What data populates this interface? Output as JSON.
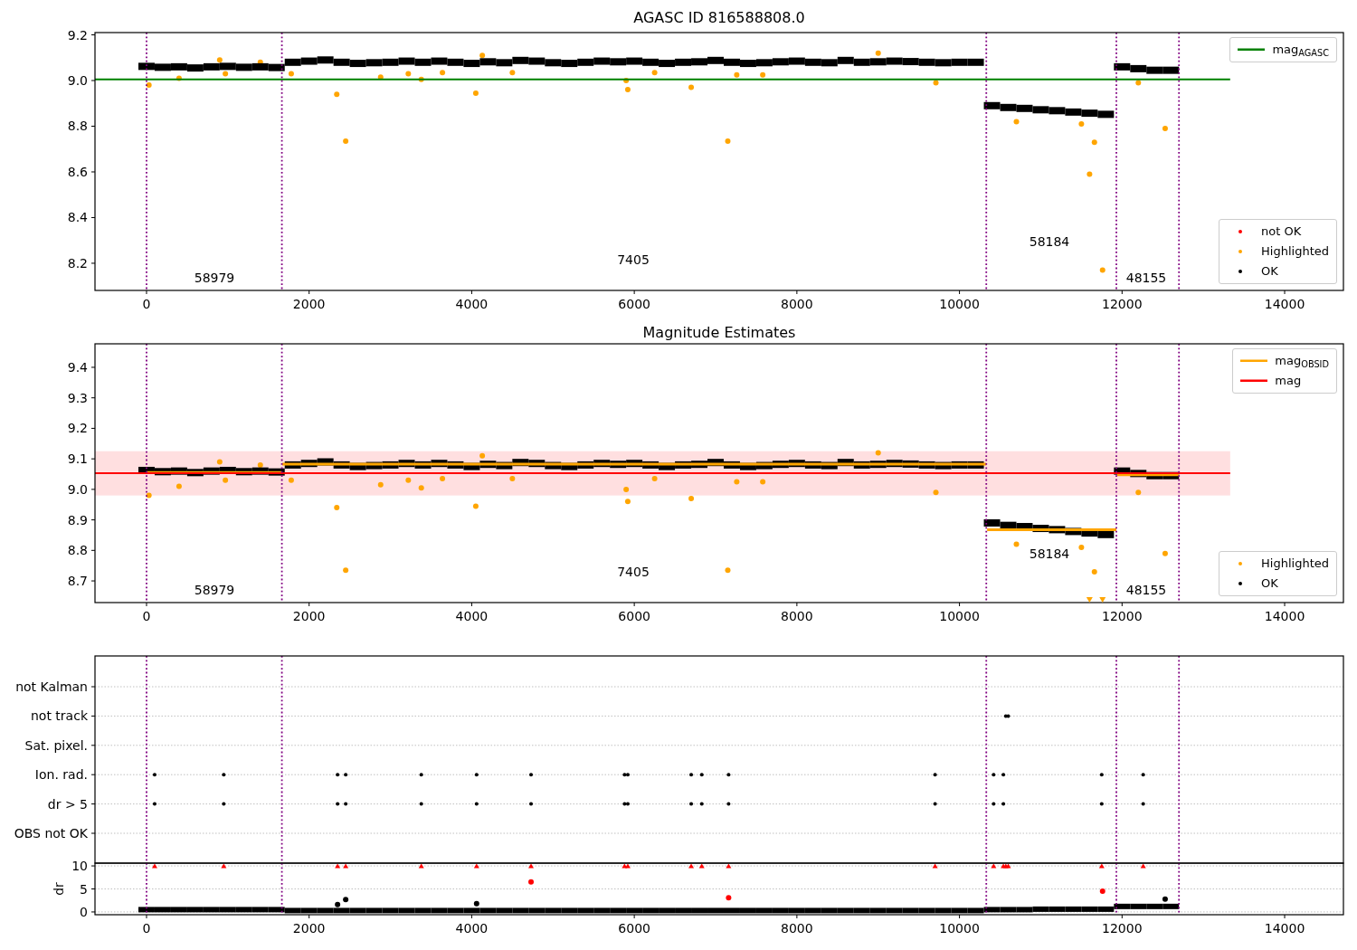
{
  "figure": {
    "panels": [
      {
        "title": "AGASC ID 816588808.0",
        "chart_data": {
          "type": "scatter",
          "xlim": [
            -634,
            14723
          ],
          "ylim": [
            8.081,
            9.21
          ],
          "xticks": [
            0,
            2000,
            4000,
            6000,
            8000,
            10000,
            12000,
            14000
          ],
          "yticks": [
            {
              "value": 8.2,
              "label": "8.2"
            },
            {
              "value": 8.4,
              "label": "8.4"
            },
            {
              "value": 8.6,
              "label": "8.6"
            },
            {
              "value": 8.8,
              "label": "8.8"
            },
            {
              "value": 9,
              "label": "9.0"
            },
            {
              "value": 9.2,
              "label": "9.2"
            }
          ],
          "series": [
            {
              "name": "not OK",
              "color": "#ff0000",
              "marker": "circle"
            },
            {
              "name": "Highlighted",
              "color": "#ffa500",
              "marker": "circle",
              "x": [
                30,
                400,
                900,
                970,
                1400,
                1780,
                2340,
                2450,
                2880,
                3220,
                3380,
                3640,
                4050,
                4130,
                4500,
                5900,
                5920,
                6250,
                6700,
                7150,
                7260,
                7580,
                9000,
                9710,
                10700,
                11500,
                11600,
                11660,
                11760,
                12200,
                12530
              ],
              "values": [
                8.98,
                9.01,
                9.09,
                9.03,
                9.08,
                9.03,
                8.94,
                8.735,
                9.015,
                9.03,
                9.005,
                9.035,
                8.945,
                9.11,
                9.035,
                9.0,
                8.96,
                9.035,
                8.97,
                8.735,
                9.025,
                9.025,
                9.12,
                8.99,
                8.82,
                8.81,
                8.59,
                8.73,
                8.17,
                8.99,
                8.79
              ]
            },
            {
              "name": "OK",
              "color": "#000000",
              "marker": "square",
              "x": [
                0,
                200,
                400,
                600,
                800,
                1000,
                1200,
                1400,
                1600,
                1800,
                2000,
                2200,
                2400,
                2600,
                2800,
                3000,
                3200,
                3400,
                3600,
                3800,
                4000,
                4200,
                4400,
                4600,
                4800,
                5000,
                5200,
                5400,
                5600,
                5800,
                6000,
                6200,
                6400,
                6600,
                6800,
                7000,
                7200,
                7400,
                7600,
                7800,
                8000,
                8200,
                8400,
                8600,
                8800,
                9000,
                9200,
                9400,
                9600,
                9800,
                10000,
                10200,
                10400,
                10600,
                10800,
                11000,
                11200,
                11400,
                11600,
                11800,
                12000,
                12200,
                12400,
                12600
              ],
              "values": [
                9.062,
                9.058,
                9.06,
                9.055,
                9.06,
                9.062,
                9.058,
                9.06,
                9.057,
                9.08,
                9.085,
                9.09,
                9.08,
                9.075,
                9.078,
                9.08,
                9.085,
                9.08,
                9.085,
                9.08,
                9.075,
                9.082,
                9.078,
                9.088,
                9.085,
                9.078,
                9.075,
                9.08,
                9.085,
                9.082,
                9.085,
                9.08,
                9.075,
                9.08,
                9.082,
                9.088,
                9.08,
                9.075,
                9.078,
                9.082,
                9.085,
                9.08,
                9.078,
                9.088,
                9.08,
                9.082,
                9.085,
                9.083,
                9.08,
                9.078,
                9.08,
                9.08,
                8.89,
                8.882,
                8.878,
                8.872,
                8.868,
                8.862,
                8.857,
                8.852,
                9.06,
                9.052,
                9.045,
                9.045
              ]
            },
            {
              "name": "mag$_{AGASC}$",
              "type": "line",
              "color": "#008000",
              "x": [
                -634,
                13330
              ],
              "values": [
                9.005,
                9.005
              ]
            }
          ],
          "ref_lines": [
            {
              "axis": "x",
              "value": 0
            },
            {
              "axis": "x",
              "value": 1665
            },
            {
              "axis": "x",
              "value": 10330
            },
            {
              "axis": "x",
              "value": 11930
            },
            {
              "axis": "x",
              "value": 12700
            }
          ],
          "annotations": [
            "58979",
            "7405",
            "58184",
            "48155"
          ]
        }
      },
      {
        "title": "Magnitude Estimates",
        "chart_data": {
          "type": "scatter",
          "xlim": [
            -634,
            14723
          ],
          "ylim": [
            8.629,
            9.477
          ],
          "xticks": [
            0,
            2000,
            4000,
            6000,
            8000,
            10000,
            12000,
            14000
          ],
          "yticks": [
            {
              "value": 8.7,
              "label": "8.7"
            },
            {
              "value": 8.8,
              "label": "8.8"
            },
            {
              "value": 8.9,
              "label": "8.9"
            },
            {
              "value": 9,
              "label": "9.0"
            },
            {
              "value": 9.1,
              "label": "9.1"
            },
            {
              "value": 9.2,
              "label": "9.2"
            },
            {
              "value": 9.3,
              "label": "9.3"
            },
            {
              "value": 9.4,
              "label": "9.4"
            }
          ],
          "series": [
            {
              "name": "Highlighted",
              "color": "#ffa500",
              "marker": "circle",
              "x": [
                30,
                400,
                900,
                970,
                1400,
                1780,
                2340,
                2450,
                2880,
                3220,
                3380,
                3640,
                4050,
                4130,
                4500,
                5900,
                5920,
                6250,
                6700,
                7150,
                7260,
                7580,
                9000,
                9710,
                10700,
                11500,
                11600,
                11660,
                11760,
                12200,
                12530
              ],
              "values": [
                8.98,
                9.01,
                9.09,
                9.03,
                9.08,
                9.03,
                8.94,
                8.735,
                9.015,
                9.03,
                9.005,
                9.035,
                8.945,
                9.11,
                9.035,
                9.0,
                8.96,
                9.035,
                8.97,
                8.735,
                9.025,
                9.025,
                9.12,
                8.99,
                8.82,
                8.81,
                null,
                8.73,
                null,
                8.99,
                8.79
              ]
            },
            {
              "name": "OK",
              "color": "#000000",
              "marker": "square",
              "x": [
                0,
                200,
                400,
                600,
                800,
                1000,
                1200,
                1400,
                1600,
                1800,
                2000,
                2200,
                2400,
                2600,
                2800,
                3000,
                3200,
                3400,
                3600,
                3800,
                4000,
                4200,
                4400,
                4600,
                4800,
                5000,
                5200,
                5400,
                5600,
                5800,
                6000,
                6200,
                6400,
                6600,
                6800,
                7000,
                7200,
                7400,
                7600,
                7800,
                8000,
                8200,
                8400,
                8600,
                8800,
                9000,
                9200,
                9400,
                9600,
                9800,
                10000,
                10200,
                10400,
                10600,
                10800,
                11000,
                11200,
                11400,
                11600,
                11800,
                12000,
                12200,
                12400,
                12600
              ],
              "values": [
                9.062,
                9.058,
                9.06,
                9.055,
                9.06,
                9.062,
                9.058,
                9.06,
                9.057,
                9.08,
                9.085,
                9.09,
                9.08,
                9.075,
                9.078,
                9.08,
                9.085,
                9.08,
                9.085,
                9.08,
                9.075,
                9.082,
                9.078,
                9.088,
                9.085,
                9.078,
                9.075,
                9.08,
                9.085,
                9.082,
                9.085,
                9.08,
                9.075,
                9.08,
                9.082,
                9.088,
                9.08,
                9.075,
                9.078,
                9.082,
                9.085,
                9.08,
                9.078,
                9.088,
                9.08,
                9.082,
                9.085,
                9.083,
                9.08,
                9.078,
                9.08,
                9.08,
                8.89,
                8.882,
                8.878,
                8.872,
                8.868,
                8.862,
                8.857,
                8.852,
                9.06,
                9.052,
                9.045,
                9.045
              ]
            },
            {
              "name": "mag$_{OBSID}$",
              "type": "line",
              "color": "#ffa500",
              "x": [
                0,
                1660,
                null,
                1670,
                10330,
                null,
                10340,
                11930,
                null,
                11940,
                12700
              ],
              "values": [
                9.055,
                9.055,
                null,
                9.083,
                9.083,
                null,
                8.868,
                8.868,
                null,
                9.048,
                9.048
              ]
            },
            {
              "name": "mag",
              "type": "line",
              "color": "#ff0000",
              "x": [
                -634,
                13330
              ],
              "values": [
                9.053,
                9.053
              ]
            }
          ],
          "bands": [
            {
              "axis": "y",
              "from": 8.98,
              "to": 9.125,
              "color": "#ffdfe0"
            }
          ],
          "ref_lines": [
            {
              "axis": "x",
              "value": 0
            },
            {
              "axis": "x",
              "value": 1665
            },
            {
              "axis": "x",
              "value": 10330
            },
            {
              "axis": "x",
              "value": 11930
            },
            {
              "axis": "x",
              "value": 12700
            }
          ],
          "annotations": [
            "58979",
            "7405",
            "58184",
            "48155"
          ]
        }
      },
      {
        "flag_rows": [
          {
            "label": "not Kalman"
          },
          {
            "label": "not track"
          },
          {
            "label": "Sat. pixel."
          },
          {
            "label": "Ion. rad."
          },
          {
            "label": "dr > 5"
          },
          {
            "label": "OBS not OK"
          }
        ]
      },
      {
        "chart_data": {
          "type": "scatter",
          "ylabel": "dr",
          "xlim": [
            -634,
            14723
          ],
          "ylim": [
            -0.6,
            10.6
          ],
          "grid": true,
          "xticks": [
            0,
            2000,
            4000,
            6000,
            8000,
            10000,
            12000,
            14000
          ],
          "yticks": [
            0,
            5,
            10
          ],
          "series": [
            {
              "color": "#000000",
              "marker": "square",
              "x": [
                0,
                200,
                400,
                600,
                800,
                1000,
                1200,
                1400,
                1600,
                1800,
                2000,
                2200,
                2400,
                2600,
                2800,
                3000,
                3200,
                3400,
                3600,
                3800,
                4000,
                4200,
                4400,
                4600,
                4800,
                5000,
                5200,
                5400,
                5600,
                5800,
                6000,
                6200,
                6400,
                6600,
                6800,
                7000,
                7200,
                7400,
                7600,
                7800,
                8000,
                8200,
                8400,
                8600,
                8800,
                9000,
                9200,
                9400,
                9600,
                9800,
                10000,
                10200,
                10400,
                10600,
                10800,
                11000,
                11200,
                11400,
                11600,
                11800,
                12000,
                12200,
                12400,
                12600
              ],
              "values": [
                0.5,
                0.5,
                0.5,
                0.5,
                0.5,
                0.5,
                0.5,
                0.5,
                0.5,
                0.3,
                0.3,
                0.3,
                0.3,
                0.3,
                0.3,
                0.3,
                0.3,
                0.3,
                0.3,
                0.3,
                0.3,
                0.3,
                0.3,
                0.3,
                0.3,
                0.3,
                0.3,
                0.3,
                0.3,
                0.3,
                0.3,
                0.3,
                0.3,
                0.3,
                0.3,
                0.3,
                0.3,
                0.3,
                0.3,
                0.3,
                0.3,
                0.3,
                0.3,
                0.3,
                0.3,
                0.3,
                0.3,
                0.3,
                0.3,
                0.3,
                0.3,
                0.3,
                0.5,
                0.5,
                0.5,
                0.6,
                0.6,
                0.6,
                0.6,
                0.6,
                1.2,
                1.2,
                1.2,
                1.2
              ]
            },
            {
              "color": "#000000",
              "marker": "circle",
              "x": [
                2350,
                2450,
                4060,
                12530
              ],
              "values": [
                1.6,
                2.7,
                1.8,
                2.8
              ]
            },
            {
              "color": "#ff0000",
              "marker": "circle",
              "x": [
                4730,
                7160,
                11760
              ],
              "values": [
                6.5,
                3.1,
                4.5
              ]
            },
            {
              "color": "#ff0000",
              "marker": "triangle",
              "x": [
                100,
                950,
                2350,
                2450,
                3380,
                4060,
                4730,
                5880,
                5920,
                6700,
                6830,
                7160,
                9700,
                10420,
                10540,
                10570,
                10600,
                11750,
                12260
              ],
              "values": [
                10,
                10,
                10,
                10,
                10,
                10,
                10,
                10,
                10,
                10,
                10,
                10,
                10,
                10,
                10,
                10,
                10,
                10,
                10
              ]
            }
          ],
          "ref_lines": [
            {
              "axis": "x",
              "value": 0
            },
            {
              "axis": "x",
              "value": 1665
            },
            {
              "axis": "x",
              "value": 10330
            },
            {
              "axis": "x",
              "value": 11930
            },
            {
              "axis": "x",
              "value": 12700
            }
          ]
        }
      }
    ]
  }
}
